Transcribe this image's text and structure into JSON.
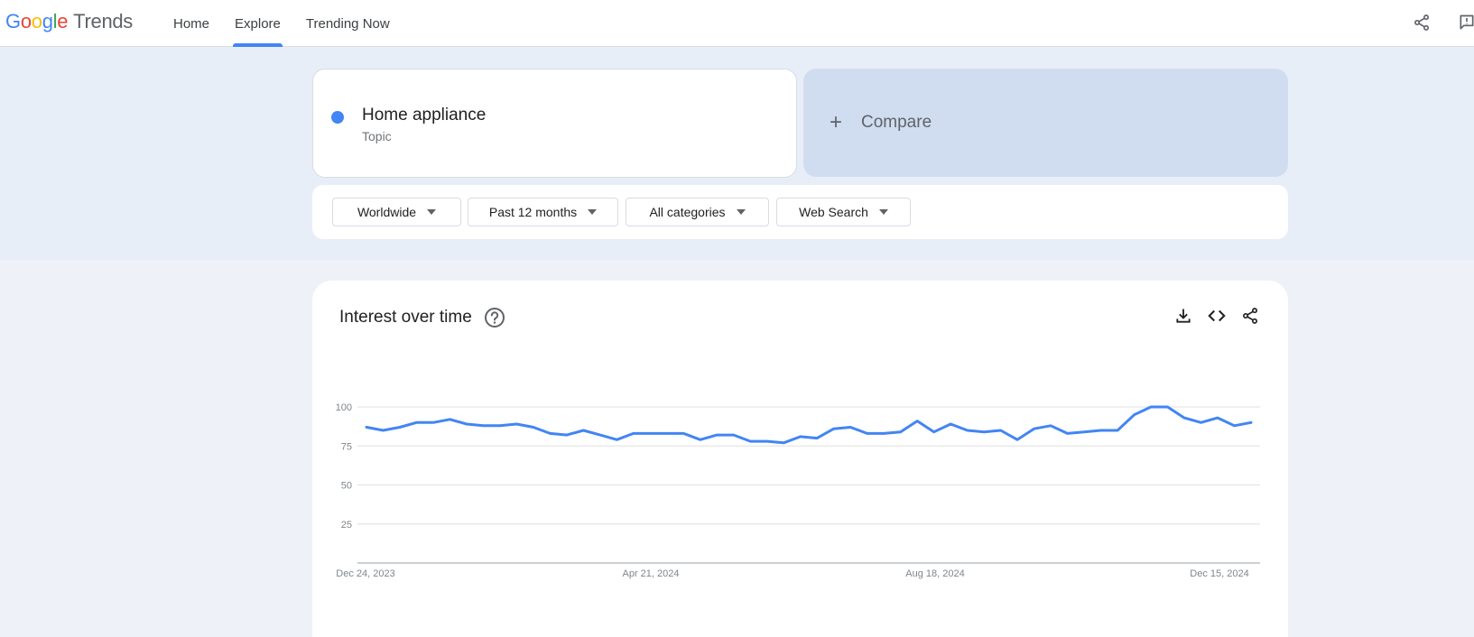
{
  "header": {
    "logo_google": "Google",
    "logo_trends": "Trends",
    "nav": [
      "Home",
      "Explore",
      "Trending Now"
    ],
    "active_nav": "Explore",
    "accent_color": "#4285f4"
  },
  "search": {
    "term": "Home appliance",
    "term_type": "Topic",
    "term_color": "#4285f4",
    "compare_label": "Compare"
  },
  "filters": [
    "Worldwide",
    "Past 12 months",
    "All categories",
    "Web Search"
  ],
  "chart": {
    "title": "Interest over time",
    "icons": [
      "help-icon",
      "download-icon",
      "embed-icon",
      "share-icon"
    ]
  },
  "chart_data": {
    "type": "line",
    "title": "Interest over time",
    "xlabel": "",
    "ylabel": "",
    "ylim": [
      0,
      100
    ],
    "yticks": [
      100,
      75,
      50,
      25
    ],
    "x_tick_labels": [
      "Dec 24, 2023",
      "Apr 21, 2024",
      "Aug 18, 2024",
      "Dec 15, 2024"
    ],
    "grid": true,
    "series": [
      {
        "name": "Home appliance",
        "color": "#4285f4",
        "values": [
          87,
          85,
          87,
          90,
          90,
          92,
          89,
          88,
          88,
          89,
          87,
          83,
          82,
          85,
          82,
          79,
          83,
          83,
          83,
          83,
          79,
          82,
          82,
          78,
          78,
          77,
          81,
          80,
          86,
          87,
          83,
          83,
          84,
          91,
          84,
          89,
          85,
          84,
          85,
          79,
          86,
          88,
          83,
          84,
          85,
          85,
          95,
          100,
          100,
          93,
          90,
          93,
          88,
          90
        ]
      }
    ]
  }
}
